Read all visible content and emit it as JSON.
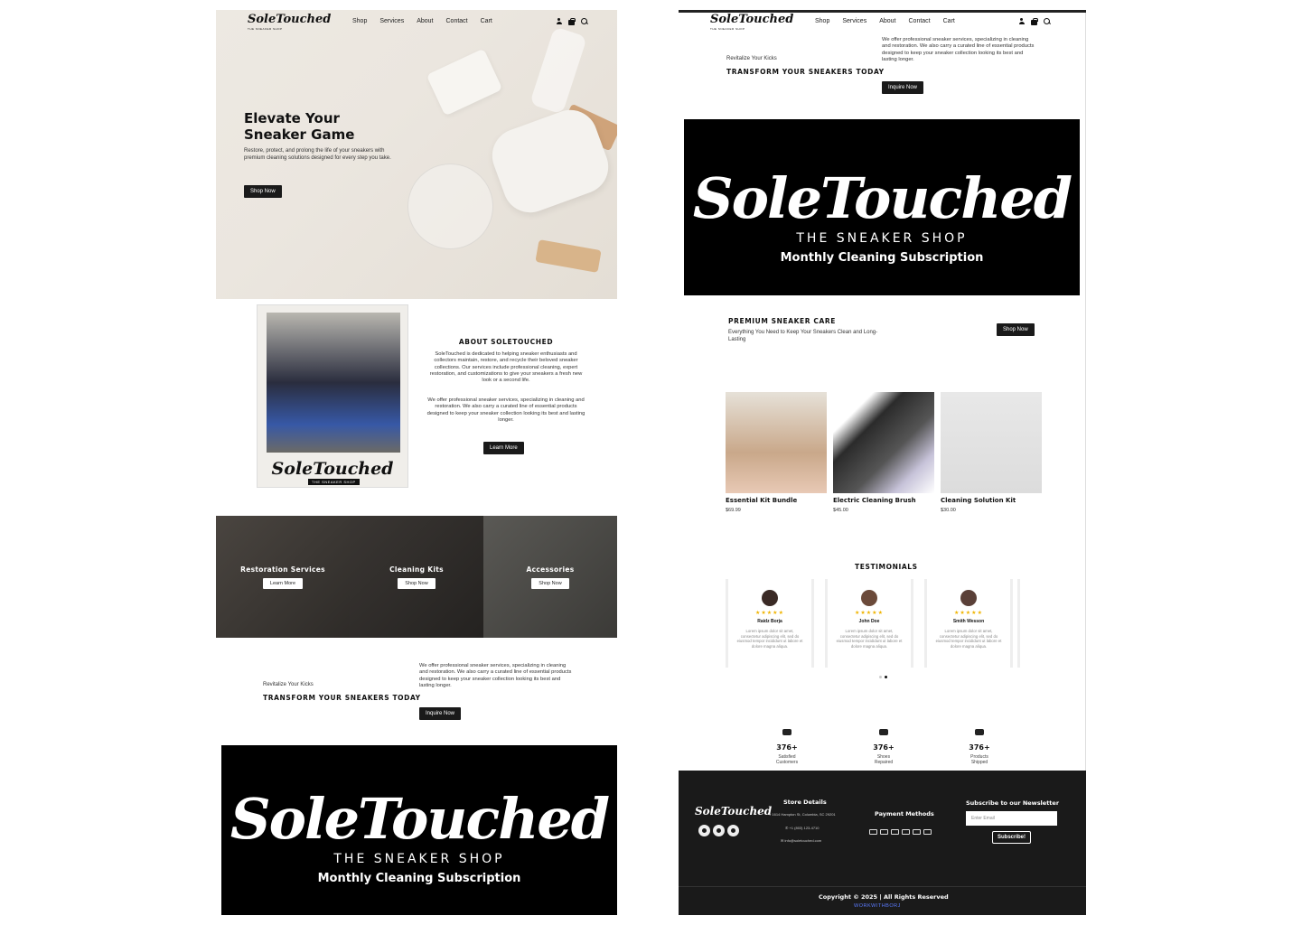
{
  "nav": {
    "logo": "SoleTouched",
    "logo_sub": "THE SNEAKER SHOP",
    "links": [
      "Shop",
      "Services",
      "About",
      "Contact",
      "Cart"
    ]
  },
  "hero": {
    "title": "Elevate Your Sneaker Game",
    "subtitle": "Restore, protect, and prolong the life of your sneakers with premium cleaning solutions designed for every step you take.",
    "button": "Shop Now"
  },
  "about": {
    "title": "ABOUT SOLETOUCHED",
    "paragraph1": "SoleTouched is dedicated to helping sneaker enthusiasts and collectors maintain, restore, and recycle their beloved sneaker collections. Our services include professional cleaning, expert restoration, and customizations to give your sneakers a fresh new look or a second life.",
    "paragraph2": "We offer professional sneaker services, specializing in cleaning and restoration. We also carry a curated line of essential products designed to keep your sneaker collection looking its best and lasting longer.",
    "button": "Learn More",
    "image_signature": "SoleTouched",
    "image_tag": "THE SNEAKER SHOP"
  },
  "categories": [
    {
      "title": "Restoration Services",
      "button": "Learn More"
    },
    {
      "title": "Cleaning Kits",
      "button": "Shop Now"
    },
    {
      "title": "Accessories",
      "button": "Shop Now"
    }
  ],
  "transform": {
    "small": "Revitalize Your Kicks",
    "title": "TRANSFORM YOUR SNEAKERS TODAY",
    "text": "We offer professional sneaker services, specializing in cleaning and restoration. We also carry a curated line of essential products designed to keep your sneaker collection looking its best and lasting longer.",
    "button": "Inquire Now"
  },
  "banner": {
    "script": "SoleTouched",
    "sub": "THE SNEAKER SHOP",
    "sub2": "Monthly Cleaning Subscription"
  },
  "premium": {
    "title": "PREMIUM SNEAKER CARE",
    "subtitle": "Everything You Need to Keep Your Sneakers Clean and Long-Lasting",
    "button": "Shop Now"
  },
  "products": [
    {
      "name": "Essential Kit Bundle",
      "price": "$69.99"
    },
    {
      "name": "Electric Cleaning Brush",
      "price": "$45.00"
    },
    {
      "name": "Cleaning Solution Kit",
      "price": "$30.00"
    }
  ],
  "testimonials": {
    "title": "TESTIMONIALS",
    "stars": "★★★★★",
    "items": [
      {
        "name": "Raidz Borja",
        "text": "Lorem ipsum dolor sit amet, consectetur adipiscing elit, sed do eiusmod tempor incididunt ut labore et dolore magna aliqua."
      },
      {
        "name": "John Doe",
        "text": "Lorem ipsum dolor sit amet, consectetur adipiscing elit, sed do eiusmod tempor incididunt ut labore et dolore magna aliqua."
      },
      {
        "name": "Smith Wesson",
        "text": "Lorem ipsum dolor sit amet, consectetur adipiscing elit, sed do eiusmod tempor incididunt ut labore et dolore magna aliqua."
      }
    ]
  },
  "stats": [
    {
      "value": "376+",
      "label1": "Satisfied",
      "label2": "Customers"
    },
    {
      "value": "376+",
      "label1": "Shoes",
      "label2": "Repaired"
    },
    {
      "value": "376+",
      "label1": "Products",
      "label2": "Shipped"
    }
  ],
  "footer": {
    "logo": "SoleTouched",
    "store_title": "Store Details",
    "address": "1614 Hampton St, Columbia, SC 29201",
    "phone": "+1 (803) 123-4710",
    "email": "info@soletouched.com",
    "payment_title": "Payment Methods",
    "newsletter_title": "Subscribe to our Newsletter",
    "email_placeholder": "Enter Email",
    "subscribe": "Subscribe!",
    "copyright": "Copyright © 2025 | All Rights Reserved",
    "credit": "WORKWITHBORJ"
  },
  "colors": {
    "dark": "#1a1a1a",
    "hero_bg": "#ebe6df",
    "star": "#f0b400",
    "credit_link": "#5b7bff"
  }
}
